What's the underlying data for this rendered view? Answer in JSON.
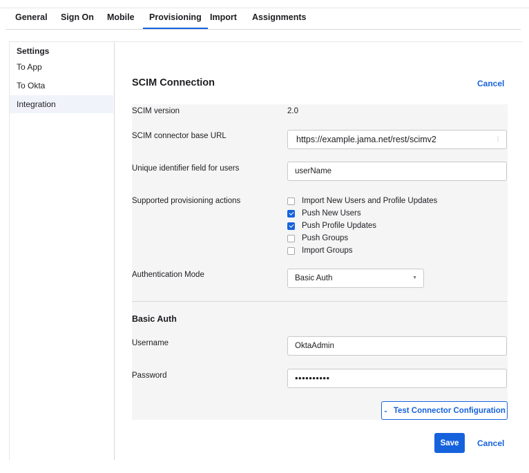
{
  "tabs": [
    {
      "label": "General"
    },
    {
      "label": "Sign On"
    },
    {
      "label": "Mobile"
    },
    {
      "label": "Provisioning"
    },
    {
      "label": "Import"
    },
    {
      "label": "Assignments"
    }
  ],
  "sidebar": {
    "heading": "Settings",
    "items": [
      {
        "label": "To App"
      },
      {
        "label": "To Okta"
      },
      {
        "label": "Integration"
      }
    ]
  },
  "section": {
    "title": "SCIM Connection",
    "cancel_label": "Cancel"
  },
  "fields": {
    "scim_version_label": "SCIM version",
    "scim_version_value": "2.0",
    "base_url_label": "SCIM connector base URL",
    "base_url_value": "https://example.jama.net/rest/scimv2",
    "unique_id_label": "Unique identifier field for users",
    "unique_id_value": "userName",
    "actions_label": "Supported provisioning actions",
    "actions": [
      {
        "label": "Import New Users and Profile Updates",
        "checked": false
      },
      {
        "label": "Push New Users",
        "checked": true
      },
      {
        "label": "Push Profile Updates",
        "checked": true
      },
      {
        "label": "Push Groups",
        "checked": false
      },
      {
        "label": "Import Groups",
        "checked": false
      }
    ],
    "auth_mode_label": "Authentication Mode",
    "auth_mode_value": "Basic Auth"
  },
  "basic_auth": {
    "heading": "Basic Auth",
    "username_label": "Username",
    "username_value": "OktaAdmin",
    "password_label": "Password",
    "password_value": "••••••••••"
  },
  "buttons": {
    "test_label": "Test Connector Configuration",
    "save_label": "Save",
    "cancel_label": "Cancel"
  },
  "colors": {
    "accent": "#1662dd",
    "panel_bg": "#f5f5f6",
    "sidebar_active": "#f0f3fa"
  }
}
